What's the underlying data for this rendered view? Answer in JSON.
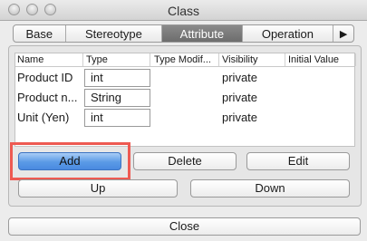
{
  "window": {
    "title": "Class"
  },
  "tabs": [
    {
      "label": "Base"
    },
    {
      "label": "Stereotype"
    },
    {
      "label": "Attribute",
      "active": true
    },
    {
      "label": "Operation"
    }
  ],
  "tab_scroll": {
    "label": "▶"
  },
  "table": {
    "columns": [
      "Name",
      "Type",
      "Type Modif...",
      "Visibility",
      "Initial Value"
    ],
    "rows": [
      {
        "name": "Product ID",
        "type": "int",
        "modifier": "",
        "visibility": "private",
        "initial": ""
      },
      {
        "name": "Product n...",
        "type": "String",
        "modifier": "",
        "visibility": "private",
        "initial": ""
      },
      {
        "name": "Unit (Yen)",
        "type": "int",
        "modifier": "",
        "visibility": "private",
        "initial": ""
      }
    ]
  },
  "buttons": {
    "add": "Add",
    "delete": "Delete",
    "edit": "Edit",
    "up": "Up",
    "down": "Down",
    "close": "Close"
  },
  "colors": {
    "highlight": "#ee5a52",
    "primary_button": "#5a9ae6",
    "active_tab": "#7a7a7a"
  }
}
